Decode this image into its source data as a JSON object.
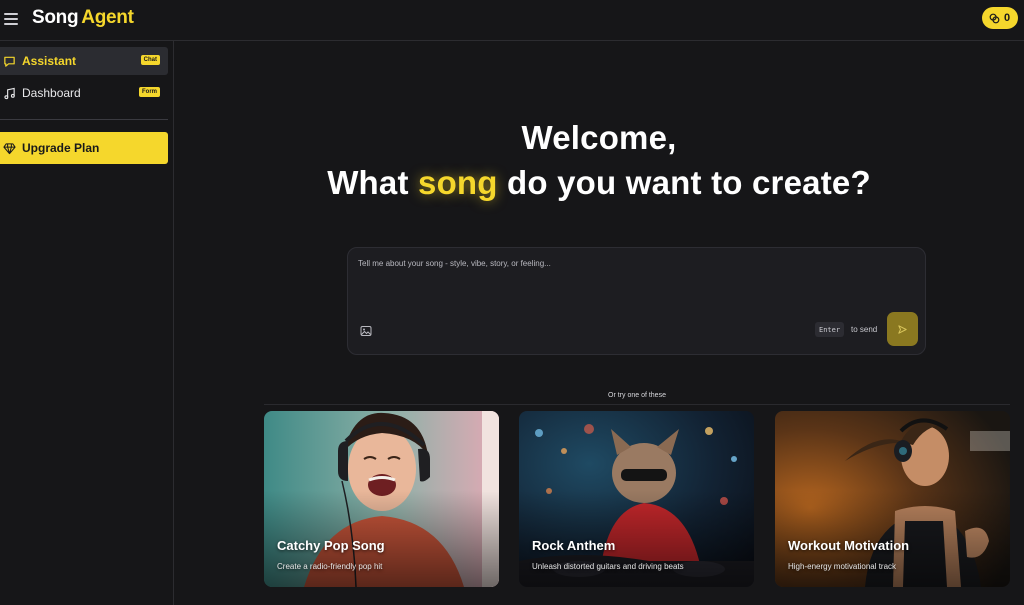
{
  "header": {
    "brand_part1": "Song",
    "brand_part2": "Agent",
    "credits": "0",
    "accent_color": "#f5d72c"
  },
  "sidebar": {
    "items": [
      {
        "label": "Assistant",
        "badge": "Chat",
        "icon": "chat-bubble-icon",
        "active": true
      },
      {
        "label": "Dashboard",
        "badge": "Form",
        "icon": "music-note-icon",
        "active": false
      }
    ],
    "upgrade_label": "Upgrade Plan",
    "upgrade_icon": "diamond-icon"
  },
  "main": {
    "welcome_line": "Welcome,",
    "prompt_before": "What",
    "prompt_highlight": "song",
    "prompt_after": "do you want to create?",
    "composer": {
      "placeholder": "Tell me about your song - style, vibe, story, or feeling...",
      "value": "",
      "enter_key": "Enter",
      "send_hint": "to send",
      "attach_icon": "image-icon",
      "send_icon": "send-arrow-icon"
    },
    "suggestions_label": "Or try one of these",
    "suggestions": [
      {
        "title": "Catchy Pop Song",
        "subtitle": "Create a radio-friendly pop hit"
      },
      {
        "title": "Rock Anthem",
        "subtitle": "Unleash distorted guitars and driving beats"
      },
      {
        "title": "Workout Motivation",
        "subtitle": "High-energy motivational track"
      }
    ]
  }
}
